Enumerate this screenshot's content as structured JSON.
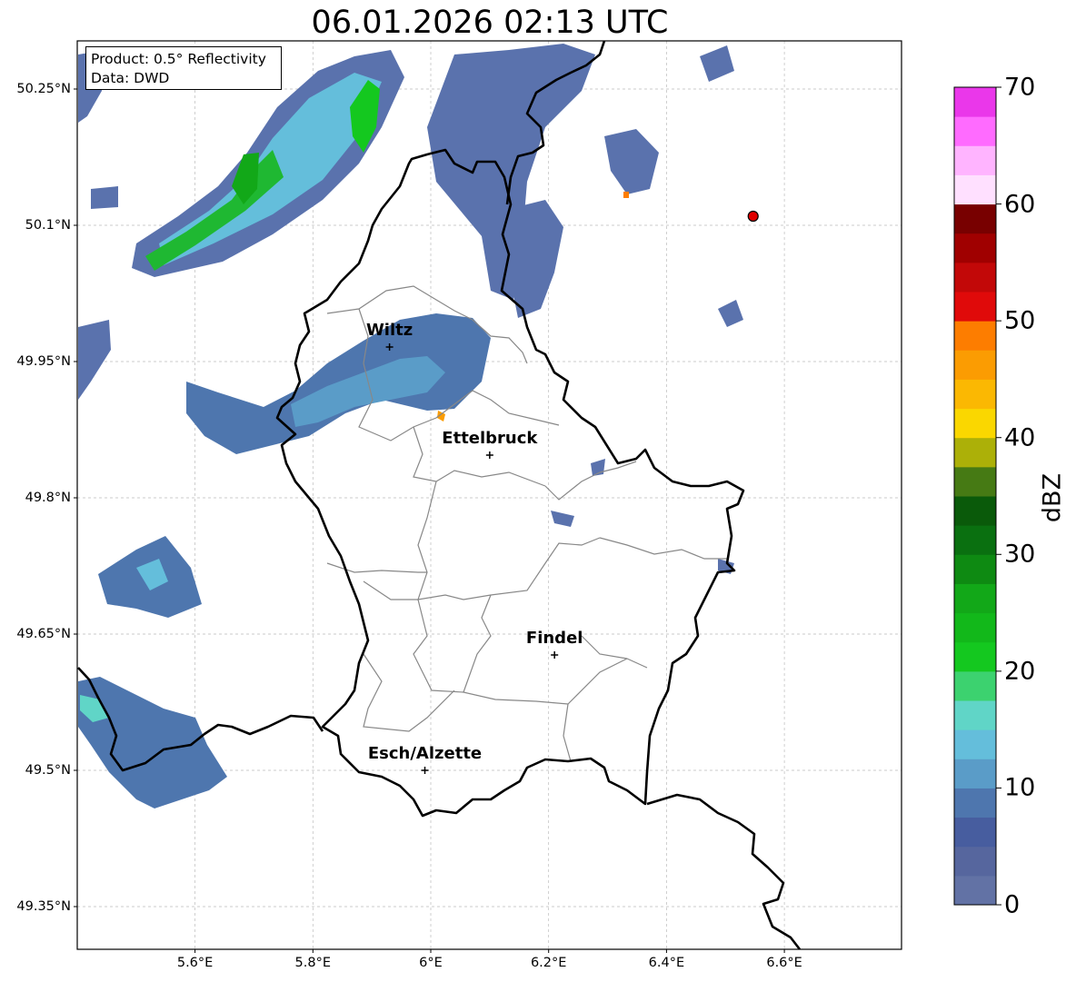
{
  "title": "06.01.2026 02:13 UTC",
  "info": {
    "product": "Product: 0.5° Reflectivity",
    "data": "Data: DWD"
  },
  "lat_labels": [
    "50.25°N",
    "50.1°N",
    "49.95°N",
    "49.8°N",
    "49.65°N",
    "49.5°N",
    "49.35°N"
  ],
  "lon_labels": [
    "5.6°E",
    "5.8°E",
    "6°E",
    "6.2°E",
    "6.4°E",
    "6.6°E"
  ],
  "cities": [
    {
      "name": "Wiltz",
      "lon": 5.93,
      "lat": 49.966
    },
    {
      "name": "Ettelbruck",
      "lon": 6.1,
      "lat": 49.847
    },
    {
      "name": "Findel",
      "lon": 6.21,
      "lat": 49.627
    },
    {
      "name": "Esch/Alzette",
      "lon": 5.99,
      "lat": 49.5
    }
  ],
  "radar_site": {
    "lon": 6.547,
    "lat": 50.11
  },
  "colorbar": {
    "label": "dBZ",
    "ticks": [
      "0",
      "10",
      "20",
      "30",
      "40",
      "50",
      "60",
      "70"
    ],
    "min": 0,
    "max": 70,
    "step": 2.5,
    "colors": [
      "#6272a5",
      "#56669e",
      "#475d9f",
      "#4e76ae",
      "#5a9cc8",
      "#64bedb",
      "#60d5c7",
      "#3cd26f",
      "#14c81f",
      "#12b81a",
      "#12a818",
      "#0e8a12",
      "#0a7010",
      "#0a5a0a",
      "#467a14",
      "#acb008",
      "#fad700",
      "#fbb802",
      "#fb9c02",
      "#fd7d00",
      "#e00a0a",
      "#c20808",
      "#a00000",
      "#780000",
      "#ffe0ff",
      "#ffb4ff",
      "#ff6bff",
      "#ea37ea"
    ]
  }
}
